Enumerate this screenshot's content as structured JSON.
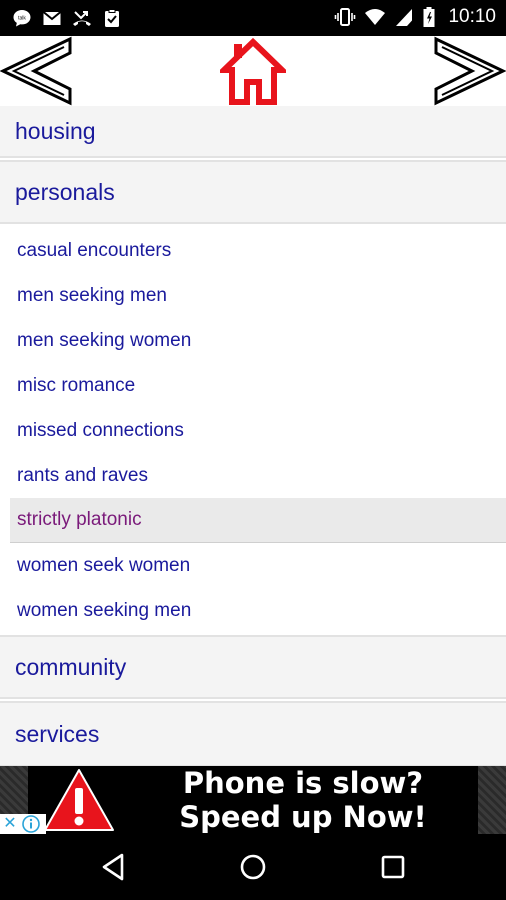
{
  "status_bar": {
    "time": "10:10",
    "icons": [
      "talk-icon",
      "gmail-icon",
      "missed-call-icon",
      "clipboard-check-icon",
      "vibrate-icon",
      "wifi-icon",
      "signal-icon",
      "battery-icon"
    ]
  },
  "nav": {
    "back": "back-arrow-icon",
    "home": "home-icon",
    "forward": "forward-arrow-icon",
    "home_color": "#e8141c"
  },
  "sections": {
    "housing": "housing",
    "personals": "personals",
    "community": "community",
    "services": "services"
  },
  "personals_items": [
    "casual encounters",
    "men seeking men",
    "men seeking women",
    "misc romance",
    "missed connections",
    "rants and raves",
    "strictly platonic",
    "women seek women",
    "women seeking men"
  ],
  "ad": {
    "line1": "Phone is slow?",
    "line2": "Speed up Now!"
  },
  "colors": {
    "link": "#1a1a9c",
    "visited": "#7a1a7a"
  }
}
